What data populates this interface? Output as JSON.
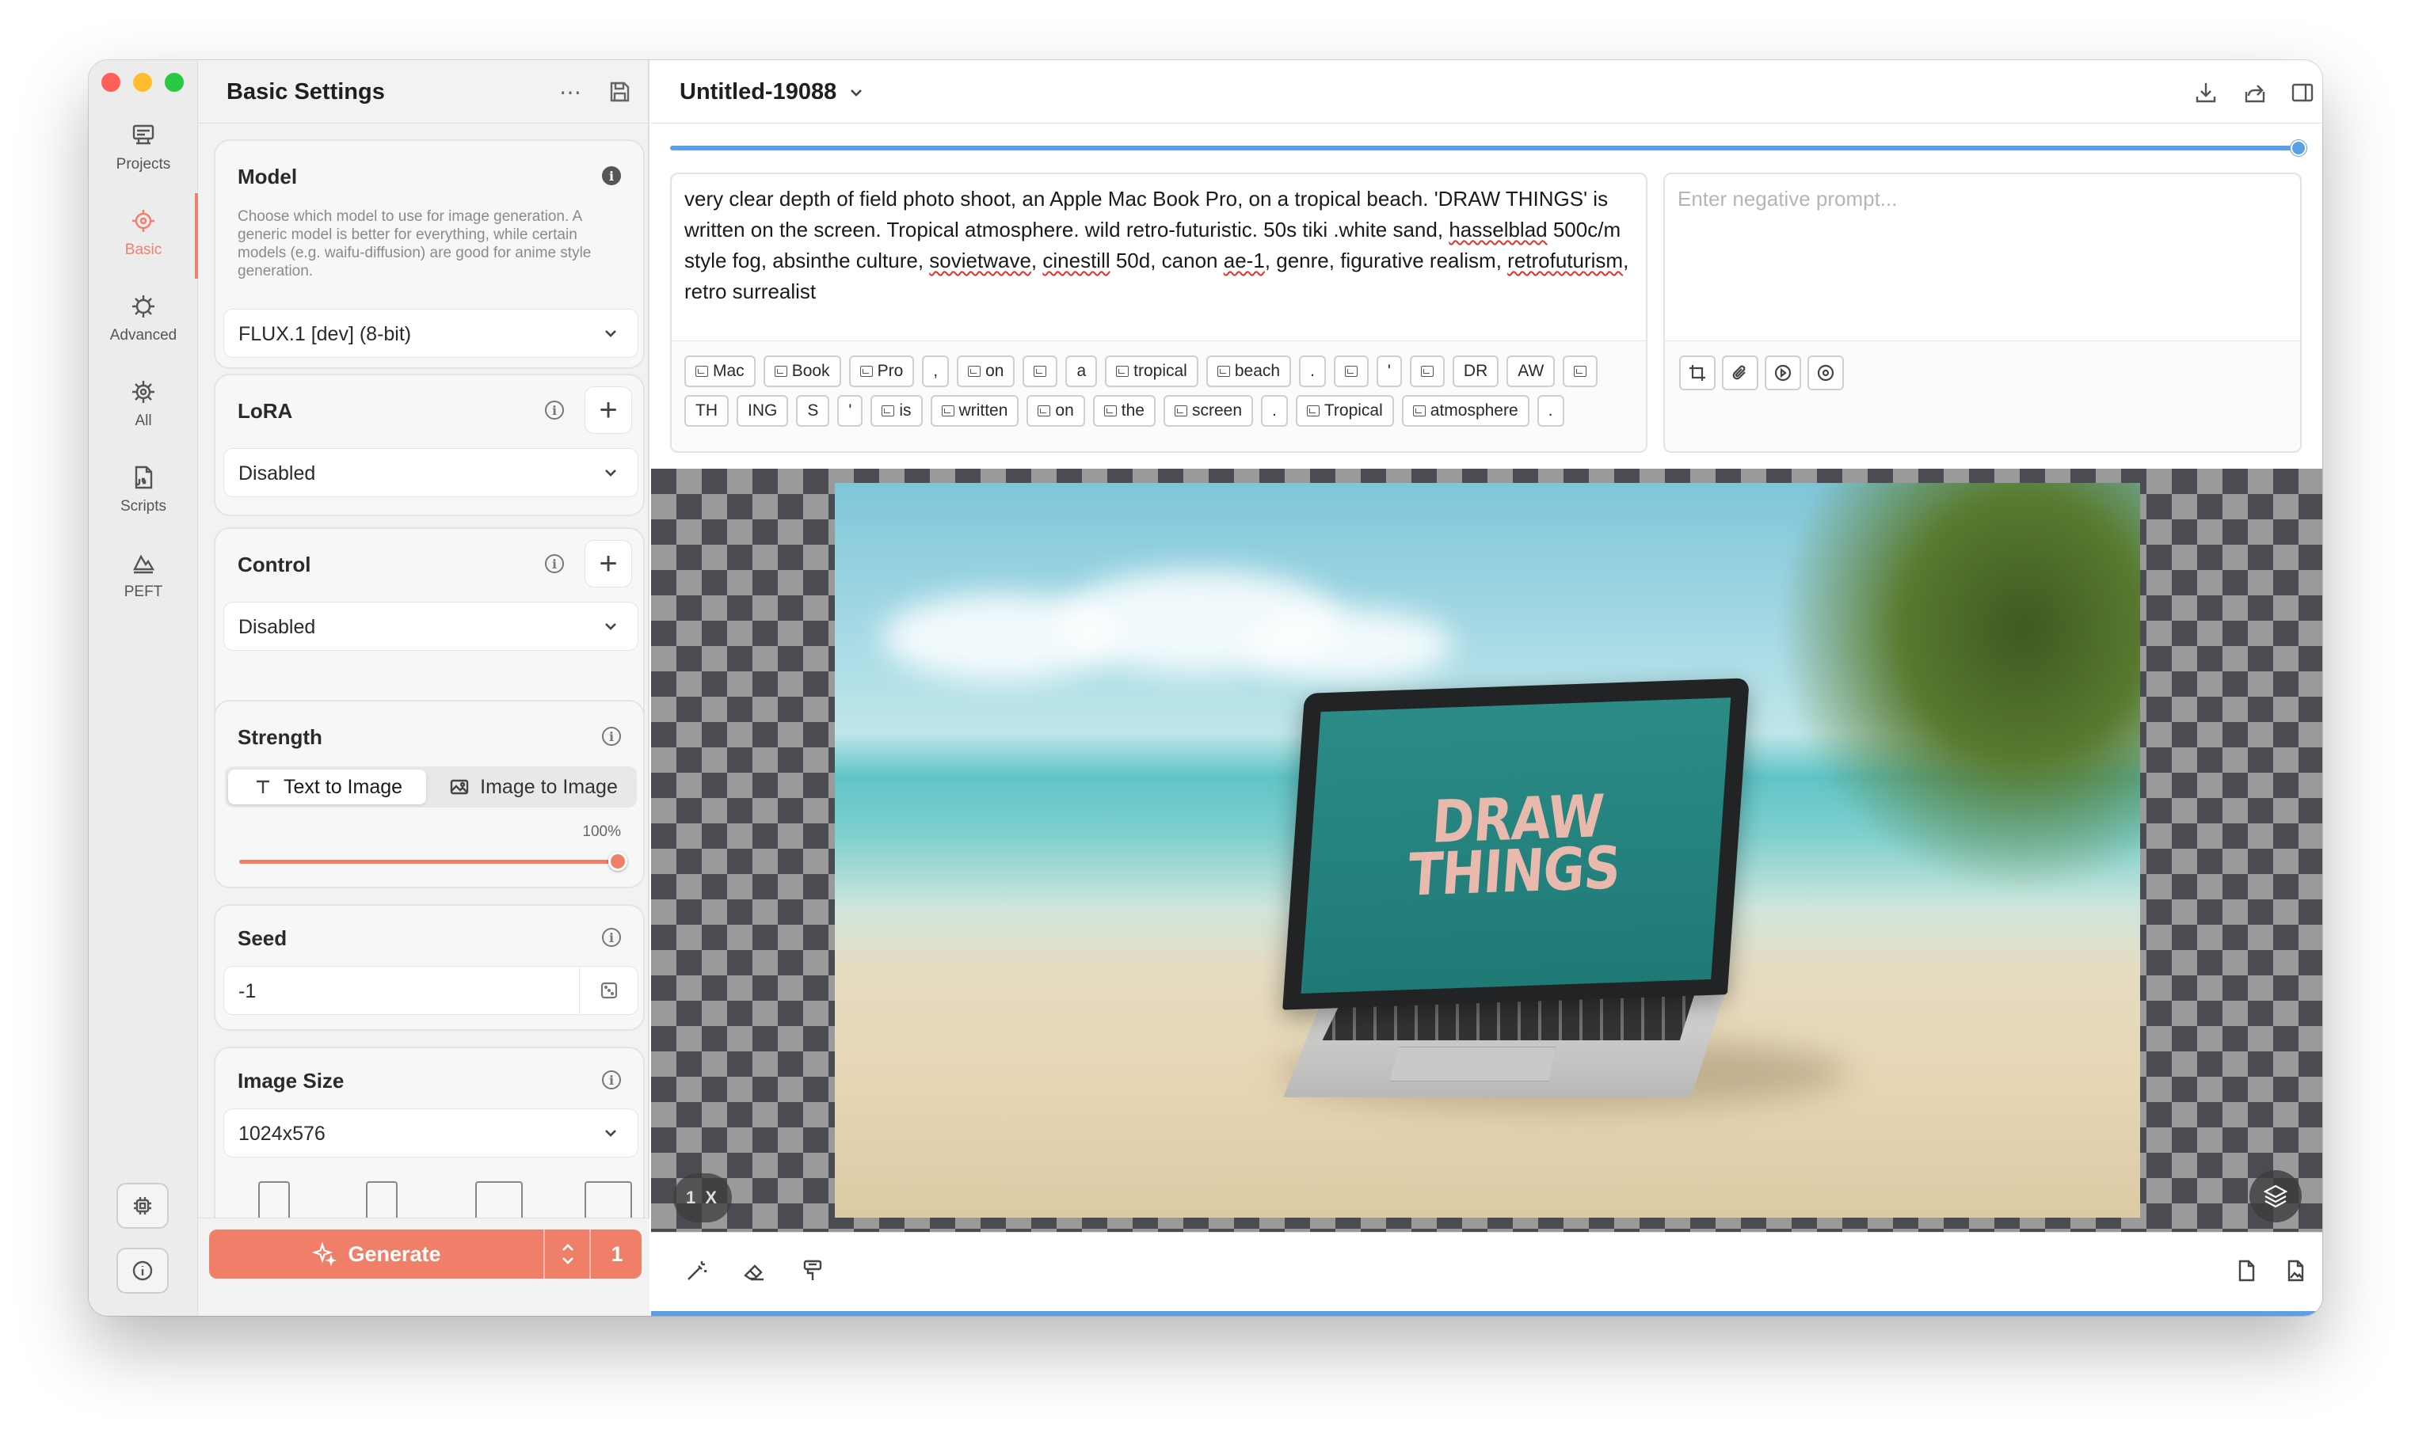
{
  "rail": {
    "items": [
      {
        "label": "Projects",
        "icon": "projects-icon"
      },
      {
        "label": "Basic",
        "icon": "basic-icon",
        "active": true
      },
      {
        "label": "Advanced",
        "icon": "advanced-icon"
      },
      {
        "label": "All",
        "icon": "all-icon"
      },
      {
        "label": "Scripts",
        "icon": "scripts-icon"
      },
      {
        "label": "PEFT",
        "icon": "peft-icon"
      }
    ]
  },
  "settings": {
    "title": "Basic Settings",
    "model": {
      "title": "Model",
      "description": "Choose which model to use for image generation. A generic model is better for everything, while certain models (e.g. waifu-diffusion) are good for anime style generation.",
      "value": "FLUX.1 [dev] (8-bit)"
    },
    "lora": {
      "title": "LoRA",
      "value": "Disabled"
    },
    "control": {
      "title": "Control",
      "value": "Disabled"
    },
    "strength": {
      "title": "Strength",
      "mode_text": "Text to Image",
      "mode_image": "Image to Image",
      "percent_label": "100%",
      "value": 1.0
    },
    "seed": {
      "title": "Seed",
      "value": "-1"
    },
    "image_size": {
      "title": "Image Size",
      "value": "1024x576"
    },
    "generate": {
      "label": "Generate",
      "count": "1"
    }
  },
  "main": {
    "title": "Untitled-19088",
    "progress": 1.0,
    "prompt": {
      "segments": [
        {
          "t": "very clear depth of field photo shoot, an Apple Mac Book Pro, on a tropical beach. 'DRAW THINGS' is written on the screen. Tropical atmosphere. wild retro-futuristic. 50s tiki .white sand, ",
          "sq": false
        },
        {
          "t": "hasselblad",
          "sq": true
        },
        {
          "t": " 500c/m style fog, absinthe culture, ",
          "sq": false
        },
        {
          "t": "sovietwave",
          "sq": true
        },
        {
          "t": ", ",
          "sq": false
        },
        {
          "t": "cinestill",
          "sq": true
        },
        {
          "t": " 50d, canon ",
          "sq": false
        },
        {
          "t": "ae-1",
          "sq": true
        },
        {
          "t": ", genre, figurative realism, ",
          "sq": false
        },
        {
          "t": "retrofuturism",
          "sq": true
        },
        {
          "t": ", retro surrealist",
          "sq": false
        }
      ]
    },
    "tokens": {
      "row1": [
        {
          "t": "Mac",
          "i": true
        },
        {
          "t": "Book",
          "i": true
        },
        {
          "t": "Pro",
          "i": true
        },
        {
          "t": ",",
          "i": false
        },
        {
          "t": "on",
          "i": true
        },
        {
          "t": "",
          "i": true
        },
        {
          "t": "a",
          "i": false
        },
        {
          "t": "tropical",
          "i": true
        },
        {
          "t": "beach",
          "i": true
        },
        {
          "t": ".",
          "i": false
        },
        {
          "t": "",
          "i": true
        },
        {
          "t": "'",
          "i": false
        },
        {
          "t": "",
          "i": true
        },
        {
          "t": "DR",
          "i": false
        },
        {
          "t": "AW",
          "i": false
        },
        {
          "t": "",
          "i": true
        }
      ],
      "row2": [
        {
          "t": "TH",
          "i": false
        },
        {
          "t": "ING",
          "i": false
        },
        {
          "t": "S",
          "i": false
        },
        {
          "t": "'",
          "i": false
        },
        {
          "t": "is",
          "i": true
        },
        {
          "t": "written",
          "i": true
        },
        {
          "t": "on",
          "i": true
        },
        {
          "t": "the",
          "i": true
        },
        {
          "t": "screen",
          "i": true
        },
        {
          "t": ".",
          "i": false
        },
        {
          "t": "Tropical",
          "i": true
        },
        {
          "t": "atmosphere",
          "i": true
        },
        {
          "t": ".",
          "i": false
        }
      ]
    },
    "negative_placeholder": "Enter negative prompt...",
    "canvas": {
      "screen_text_1": "DRAW",
      "screen_text_2": "THINGS",
      "zoom": "1 X"
    }
  }
}
